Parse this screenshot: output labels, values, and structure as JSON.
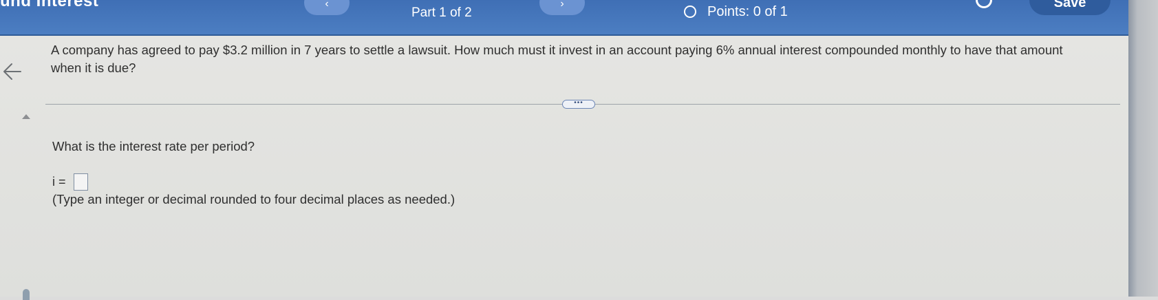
{
  "header": {
    "title": "und Interest",
    "prev_label": "‹",
    "next_label": "›",
    "part_label": "Part 1 of 2",
    "points_label": "Points: 0 of 1",
    "save_label": "Save"
  },
  "question": {
    "text_line1": "A company has agreed to pay $3.2 million in 7 years to settle a lawsuit. How much must it invest in an account paying 6% annual interest compounded monthly to have that amount",
    "text_line2": "when it is due?"
  },
  "expand_label": "•••",
  "part1": {
    "prompt": "What is the interest rate per period?",
    "answer_label": "i =",
    "answer_value": "",
    "hint": "(Type an integer or decimal rounded to four decimal places as needed.)"
  },
  "icons": {
    "back": "back-arrow-icon",
    "points": "circle-outline-icon",
    "settings": "gear-icon"
  },
  "colors": {
    "header_bg": "#4474ba",
    "save_bg": "#2f5c9d",
    "page_bg": "#e3e3e0",
    "text": "#2f2f2f"
  }
}
